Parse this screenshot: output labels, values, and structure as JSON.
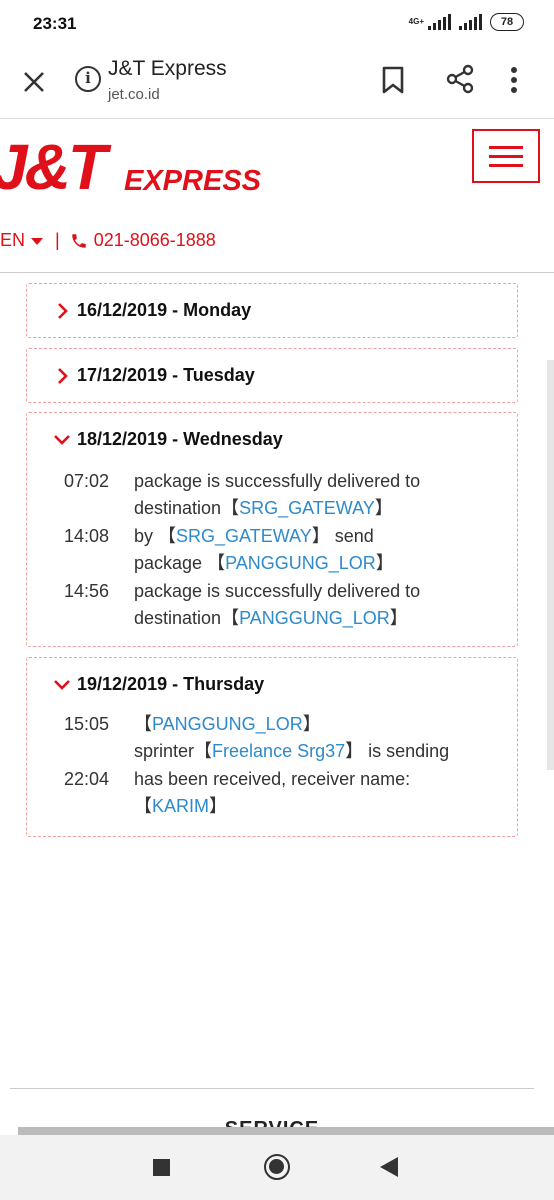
{
  "status_bar": {
    "time": "23:31",
    "network": "4G+",
    "battery": "78"
  },
  "browser": {
    "title": "J&T Express",
    "url": "jet.co.id",
    "info_icon": "i"
  },
  "site_header": {
    "logo_main": "J&T",
    "logo_sub": "EXPRESS",
    "language": "EN",
    "separator": "|",
    "phone": "021-8066-1888",
    "brand_color": "#e0101a"
  },
  "tracking": {
    "days": [
      {
        "label": "16/12/2019 - Monday",
        "expanded": false
      },
      {
        "label": "17/12/2019 - Tuesday",
        "expanded": false
      },
      {
        "label": "18/12/2019 - Wednesday",
        "expanded": true,
        "events": [
          {
            "time": "07:02",
            "text1": "package is successfully delivered to",
            "text2": "destination",
            "lb": "【",
            "location": "SRG_GATEWAY",
            "rb": "】"
          },
          {
            "time": "14:08",
            "by": "by",
            "lb": "【",
            "location": "SRG_GATEWAY",
            "rb": "】",
            "action": "send",
            "pkg": "package",
            "lb2": "【",
            "location2": "PANGGUNG_LOR",
            "rb2": "】"
          },
          {
            "time": "14:56",
            "text1": "package is successfully delivered to",
            "text2": "destination",
            "lb": "【",
            "location": "PANGGUNG_LOR",
            "rb": "】"
          }
        ]
      },
      {
        "label": "19/12/2019 - Thursday",
        "expanded": true,
        "events": [
          {
            "time": "15:05",
            "lb": "【",
            "location": "PANGGUNG_LOR",
            "rb": "】",
            "line2a": "sprinter",
            "lb2": "【",
            "courier": "Freelance Srg37",
            "rb2": "】",
            "line2b": "is sending"
          },
          {
            "time": "22:04",
            "text1": "has been received, receiver name:",
            "lb": "【",
            "receiver": "KARIM",
            "rb": "】"
          }
        ]
      }
    ]
  },
  "footer": {
    "service_label": "SERVICE"
  }
}
